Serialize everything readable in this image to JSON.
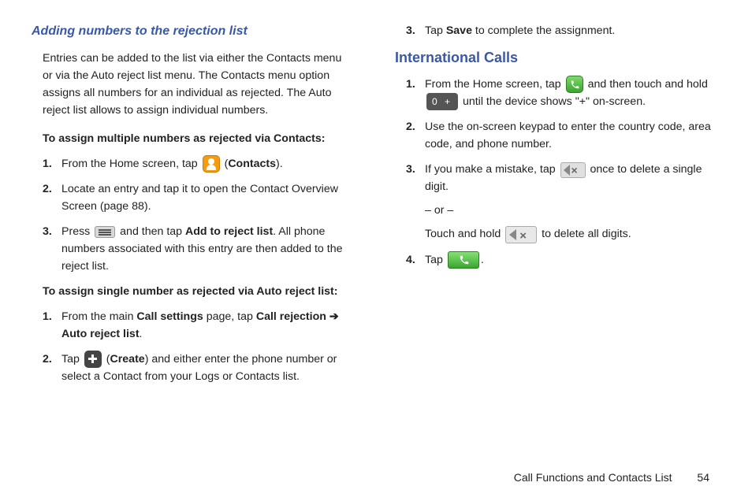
{
  "left": {
    "heading": "Adding numbers to the rejection list",
    "intro": "Entries can be added to the list via either the Contacts menu or via the Auto reject list menu. The Contacts menu option assigns all numbers for an individual as rejected. The Auto reject list allows to assign individual numbers.",
    "sub1": "To assign multiple numbers as rejected via Contacts:",
    "list1": {
      "i1a": "From the Home screen, tap ",
      "i1b": " (",
      "i1c": "Contacts",
      "i1d": ").",
      "i2": "Locate an entry and tap it to open the Contact Overview Screen (page 88).",
      "i3a": "Press ",
      "i3b": " and then tap ",
      "i3c": "Add to reject list",
      "i3d": ". All phone numbers associated with this entry are then added to the reject list."
    },
    "sub2": "To assign single number as rejected via Auto reject list:",
    "list2": {
      "i1a": "From the main ",
      "i1b": "Call settings",
      "i1c": " page, tap ",
      "i1d": "Call rejection ➔ Auto reject list",
      "i1e": ".",
      "i2a": "Tap ",
      "i2b": " (",
      "i2c": "Create",
      "i2d": ") and either enter the phone number or select a Contact from your Logs or Contacts list."
    }
  },
  "right": {
    "top": {
      "num": "3.",
      "a": "Tap ",
      "b": "Save",
      "c": " to complete the assignment."
    },
    "heading": "International Calls",
    "list": {
      "i1a": "From the Home screen, tap ",
      "i1b": " and then touch and hold ",
      "i1c": " until the device shows  \"+\" on-screen.",
      "i2": "Use the on-screen keypad to enter the country code, area code, and phone number.",
      "i3a": "If you make a mistake, tap ",
      "i3b": " once to delete a single digit.",
      "i3or": "– or –",
      "i3c": "Touch and hold ",
      "i3d": " to delete all digits.",
      "i4a": "Tap ",
      "i4b": "."
    },
    "zero": "0  +"
  },
  "footer": {
    "chapter": "Call Functions and Contacts List",
    "page": "54"
  }
}
